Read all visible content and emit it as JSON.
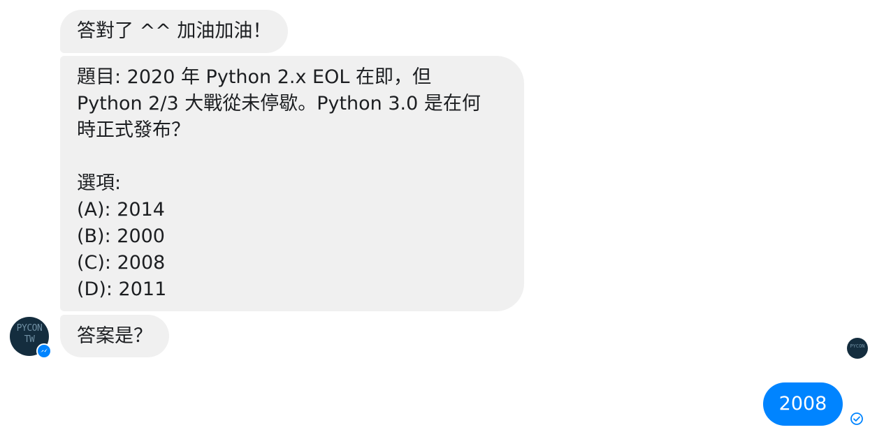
{
  "thread": {
    "received": {
      "message1": "答對了 ^^ 加油加油！",
      "message2_lines": [
        "題目: 2020 年 Python 2.x EOL 在即，但",
        "Python 2/3 大戰從未停歇。Python 3.0 是在何",
        "時正式發布？",
        "",
        "選項:",
        "(A): 2014",
        "(B): 2000",
        "(C): 2008",
        "(D): 2011"
      ],
      "message3": "答案是？"
    },
    "sent": {
      "message": "2008"
    },
    "avatar": {
      "line1": "PYCON",
      "line2": "TW"
    }
  },
  "colors": {
    "received_bubble": "#f0f0f0",
    "sent_bubble": "#0084ff",
    "avatar_bg": "#142d3e"
  },
  "icons": {
    "messenger_badge": "messenger-icon",
    "read_receipt": "check-circle-icon"
  }
}
